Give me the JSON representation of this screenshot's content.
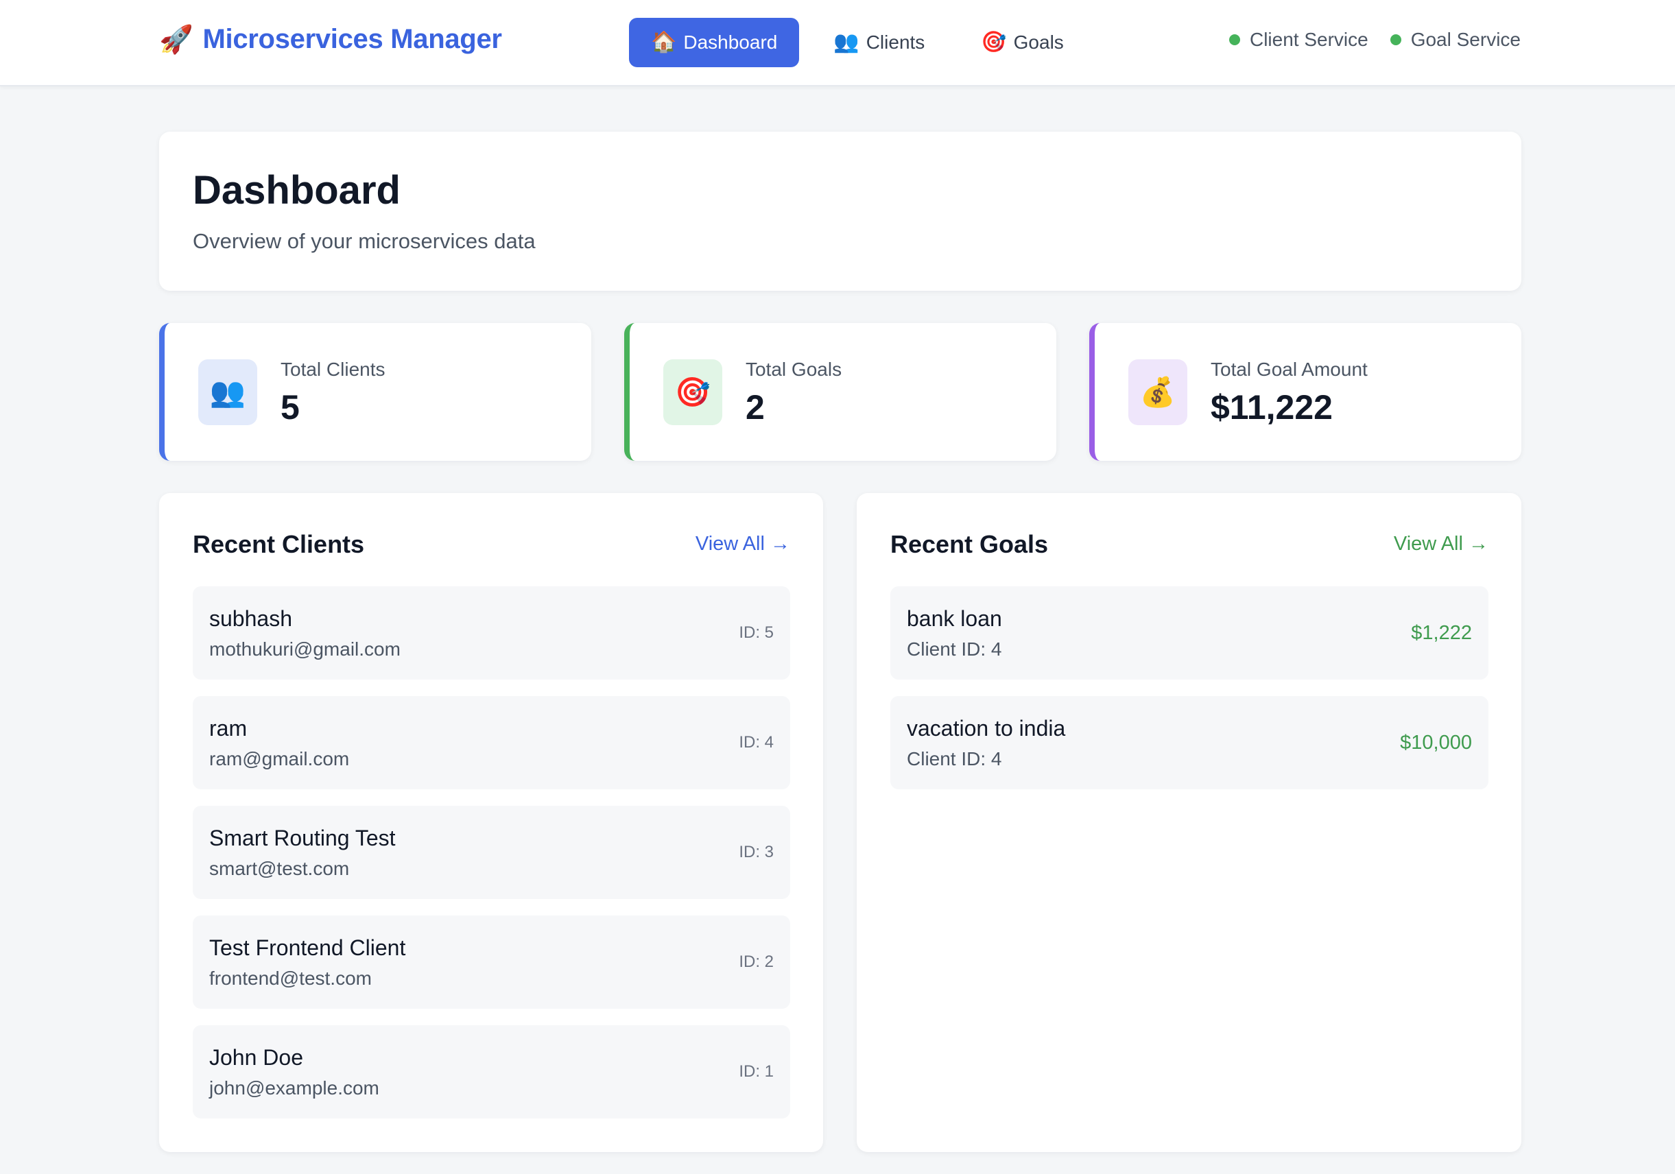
{
  "app": {
    "brand_icon": "rocket-icon",
    "brand_emoji": "🚀",
    "brand_title": "Microservices Manager",
    "accent_color": "#3f66e3"
  },
  "nav": [
    {
      "label": "Dashboard",
      "icon": "house-icon",
      "emoji": "🏠",
      "active": true
    },
    {
      "label": "Clients",
      "icon": "users-icon",
      "emoji": "👥",
      "active": false
    },
    {
      "label": "Goals",
      "icon": "target-icon",
      "emoji": "🎯",
      "active": false
    }
  ],
  "services": [
    {
      "label": "Client Service",
      "status_color": "#45b35a"
    },
    {
      "label": "Goal Service",
      "status_color": "#45b35a"
    }
  ],
  "page": {
    "title": "Dashboard",
    "subtitle": "Overview of your microservices data"
  },
  "stats": [
    {
      "label": "Total Clients",
      "value": "5",
      "icon": "users-icon",
      "emoji": "👥",
      "color": "#4a73e8"
    },
    {
      "label": "Total Goals",
      "value": "2",
      "icon": "target-icon",
      "emoji": "🎯",
      "color": "#48b25a"
    },
    {
      "label": "Total Goal Amount",
      "value": "$11,222",
      "icon": "money-bag-icon",
      "emoji": "💰",
      "color": "#9a5ee6"
    }
  ],
  "recent_clients": {
    "title": "Recent Clients",
    "view_all": "View All →",
    "items": [
      {
        "name": "subhash",
        "email": "mothukuri@gmail.com",
        "id": "ID: 5"
      },
      {
        "name": "ram",
        "email": "ram@gmail.com",
        "id": "ID: 4"
      },
      {
        "name": "Smart Routing Test",
        "email": "smart@test.com",
        "id": "ID: 3"
      },
      {
        "name": "Test Frontend Client",
        "email": "frontend@test.com",
        "id": "ID: 2"
      },
      {
        "name": "John Doe",
        "email": "john@example.com",
        "id": "ID: 1"
      }
    ]
  },
  "recent_goals": {
    "title": "Recent Goals",
    "view_all": "View All →",
    "items": [
      {
        "name": "bank loan",
        "client": "Client ID: 4",
        "amount": "$1,222"
      },
      {
        "name": "vacation to india",
        "client": "Client ID: 4",
        "amount": "$10,000"
      }
    ]
  }
}
